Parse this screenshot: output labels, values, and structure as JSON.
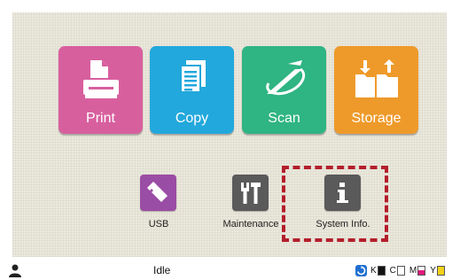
{
  "tiles": {
    "print": {
      "label": "Print",
      "color": "#d85f9e",
      "icon": "print-icon"
    },
    "copy": {
      "label": "Copy",
      "color": "#22a8dc",
      "icon": "copy-icon"
    },
    "scan": {
      "label": "Scan",
      "color": "#2fb483",
      "icon": "scan-icon"
    },
    "storage": {
      "label": "Storage",
      "color": "#ee9a2a",
      "icon": "storage-icon"
    }
  },
  "shortcuts": {
    "usb": {
      "label": "USB",
      "color": "#9a4da4",
      "icon": "usb-icon"
    },
    "maintenance": {
      "label": "Maintenance",
      "color": "#5a5a5a",
      "icon": "tools-icon"
    },
    "system_info": {
      "label": "System Info.",
      "color": "#5a5a5a",
      "icon": "info-icon"
    }
  },
  "highlight": {
    "color": "#b41e2b",
    "target": "system_info"
  },
  "status_bar": {
    "state": "Idle",
    "ink": [
      {
        "letter": "K",
        "color": "#111111",
        "level": 1.0
      },
      {
        "letter": "C",
        "color": "#00a0e0",
        "level": 0.0
      },
      {
        "letter": "M",
        "color": "#e0197d",
        "level": 0.6
      },
      {
        "letter": "Y",
        "color": "#f2d11a",
        "level": 1.0
      }
    ]
  }
}
